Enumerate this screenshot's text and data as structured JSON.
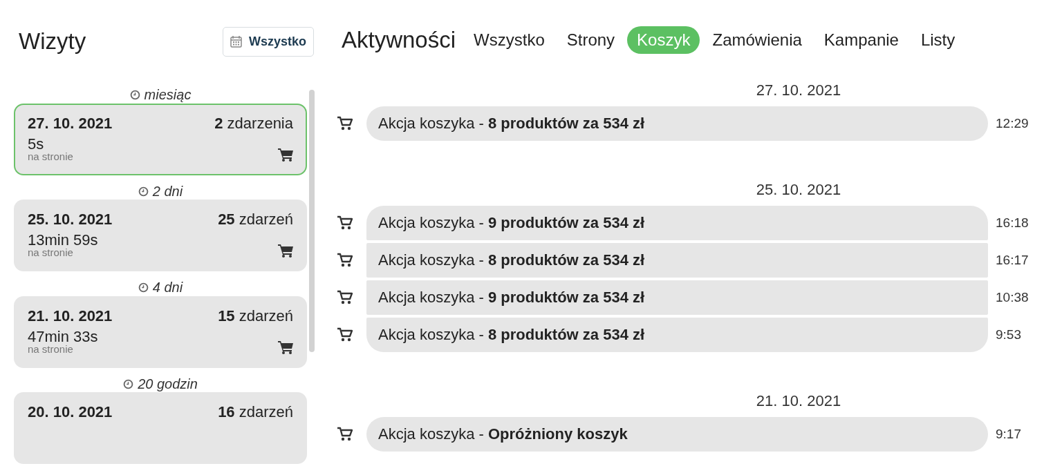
{
  "visits": {
    "title": "Wizyty",
    "filter_button": "Wszystko",
    "items": [
      {
        "ago": "miesiąc",
        "date": "27. 10. 2021",
        "events": "**2** zdarzenia",
        "duration": "5s",
        "duration_label": "na stronie",
        "selected": true
      },
      {
        "ago": "2 dni",
        "date": "25. 10. 2021",
        "events": "**25** zdarzeń",
        "duration": "13min 59s",
        "duration_label": "na stronie",
        "selected": false
      },
      {
        "ago": "4 dni",
        "date": "21. 10. 2021",
        "events": "**15** zdarzeń",
        "duration": "47min 33s",
        "duration_label": "na stronie",
        "selected": false
      },
      {
        "ago": "20 godzin",
        "date": "20. 10. 2021",
        "events": "**16** zdarzeń",
        "selected": false
      }
    ]
  },
  "activities": {
    "title": "Aktywności",
    "tabs": [
      {
        "label": "Wszystko",
        "selected": false
      },
      {
        "label": "Strony",
        "selected": false
      },
      {
        "label": "Koszyk",
        "selected": true
      },
      {
        "label": "Zamówienia",
        "selected": false
      },
      {
        "label": "Kampanie",
        "selected": false
      },
      {
        "label": "Listy",
        "selected": false
      }
    ],
    "groups": [
      {
        "date": "27. 10. 2021",
        "events": [
          {
            "text": "Akcja koszyka - **8 produktów za 534 zł**",
            "time": "12:29"
          }
        ]
      },
      {
        "date": "25. 10. 2021",
        "events": [
          {
            "text": "Akcja koszyka - **9 produktów za 534 zł**",
            "time": "16:18"
          },
          {
            "text": "Akcja koszyka - **8 produktów za 534 zł**",
            "time": "16:17"
          },
          {
            "text": "Akcja koszyka - **9 produktów za 534 zł**",
            "time": "10:38"
          },
          {
            "text": "Akcja koszyka - **8 produktów za 534 zł**",
            "time": "9:53"
          }
        ]
      },
      {
        "date": "21. 10. 2021",
        "events": [
          {
            "text": "Akcja koszyka - **Opróżniony koszyk**",
            "time": "9:17"
          }
        ]
      }
    ]
  }
}
